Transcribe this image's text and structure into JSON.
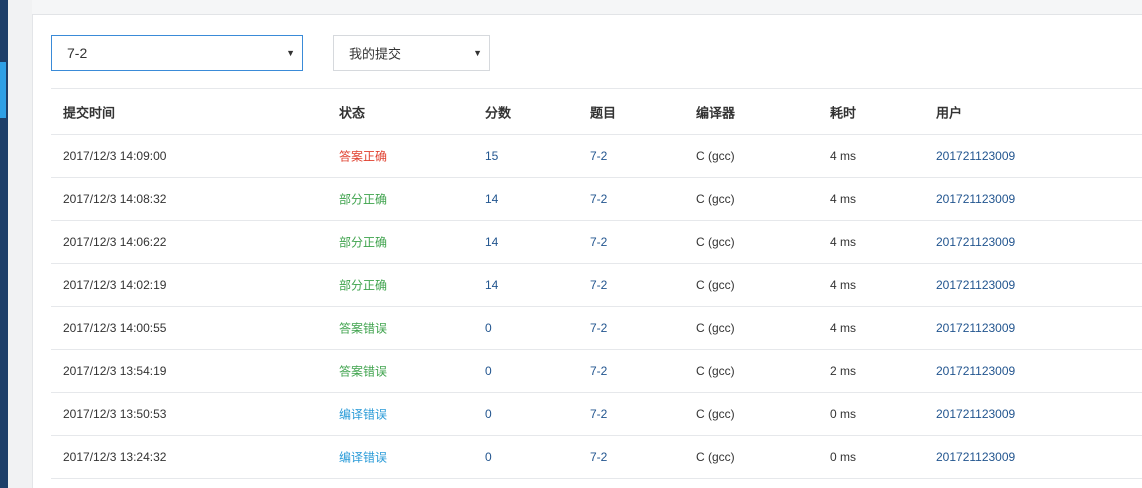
{
  "filters": {
    "problem_select": "7-2",
    "owner_select": "我的提交"
  },
  "table": {
    "headers": {
      "time": "提交时间",
      "status": "状态",
      "score": "分数",
      "problem": "题目",
      "compiler": "编译器",
      "elapsed": "耗时",
      "user": "用户"
    },
    "rows": [
      {
        "time": "2017/12/3 14:09:00",
        "status": "答案正确",
        "status_color": "#e0402f",
        "score": "15",
        "problem": "7-2",
        "compiler": "C (gcc)",
        "elapsed": "4 ms",
        "user": "201721123009"
      },
      {
        "time": "2017/12/3 14:08:32",
        "status": "部分正确",
        "status_color": "#3fa34d",
        "score": "14",
        "problem": "7-2",
        "compiler": "C (gcc)",
        "elapsed": "4 ms",
        "user": "201721123009"
      },
      {
        "time": "2017/12/3 14:06:22",
        "status": "部分正确",
        "status_color": "#3fa34d",
        "score": "14",
        "problem": "7-2",
        "compiler": "C (gcc)",
        "elapsed": "4 ms",
        "user": "201721123009"
      },
      {
        "time": "2017/12/3 14:02:19",
        "status": "部分正确",
        "status_color": "#3fa34d",
        "score": "14",
        "problem": "7-2",
        "compiler": "C (gcc)",
        "elapsed": "4 ms",
        "user": "201721123009"
      },
      {
        "time": "2017/12/3 14:00:55",
        "status": "答案错误",
        "status_color": "#3fa34d",
        "score": "0",
        "problem": "7-2",
        "compiler": "C (gcc)",
        "elapsed": "4 ms",
        "user": "201721123009"
      },
      {
        "time": "2017/12/3 13:54:19",
        "status": "答案错误",
        "status_color": "#3fa34d",
        "score": "0",
        "problem": "7-2",
        "compiler": "C (gcc)",
        "elapsed": "2 ms",
        "user": "201721123009"
      },
      {
        "time": "2017/12/3 13:50:53",
        "status": "编译错误",
        "status_color": "#2a9bd8",
        "score": "0",
        "problem": "7-2",
        "compiler": "C (gcc)",
        "elapsed": "0 ms",
        "user": "201721123009"
      },
      {
        "time": "2017/12/3 13:24:32",
        "status": "编译错误",
        "status_color": "#2a9bd8",
        "score": "0",
        "problem": "7-2",
        "compiler": "C (gcc)",
        "elapsed": "0 ms",
        "user": "201721123009"
      }
    ]
  },
  "colors": {
    "link": "#22558f",
    "nav": "#1d3f69",
    "nav_accent": "#2ea0e6"
  }
}
